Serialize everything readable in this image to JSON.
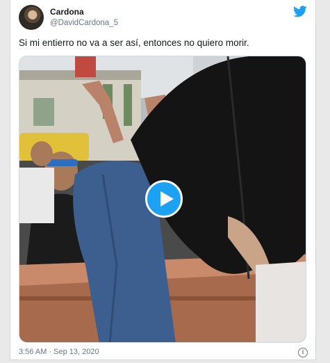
{
  "tweet": {
    "author_name": "Cardona",
    "author_handle": "@DavidCardona_5",
    "text": "Si mi entierro no va a ser así, entonces no quiero morir.",
    "timestamp": "3:56 AM · Sep 13, 2020"
  },
  "icons": {
    "brand": "twitter-bird-icon",
    "media_control": "play-icon",
    "info": "info-icon"
  },
  "colors": {
    "twitter_blue": "#1da1f2",
    "name_text": "#14171a",
    "secondary_text": "#657786"
  }
}
